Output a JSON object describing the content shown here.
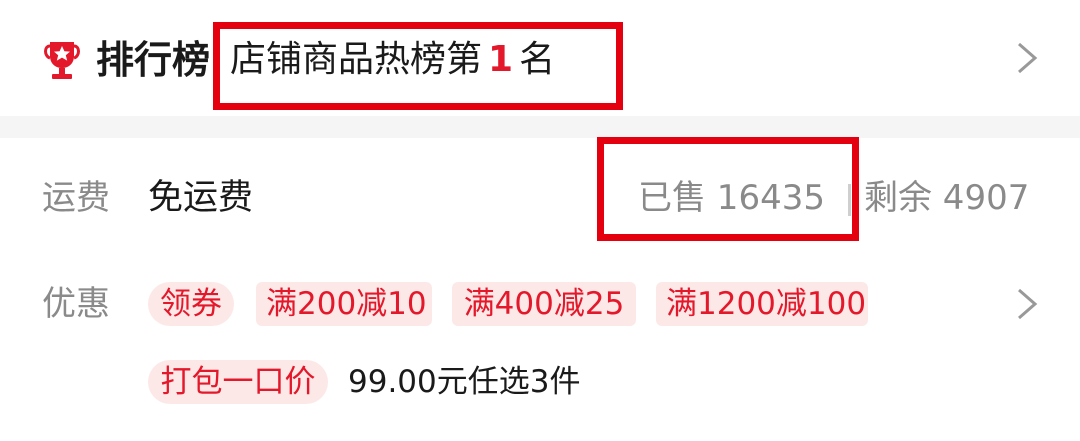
{
  "ranking": {
    "title": "排行榜",
    "text_prefix": "店铺商品热榜第",
    "rank_number": "1",
    "text_suffix": "名",
    "icon": "trophy-icon",
    "accent_color": "#e4182b"
  },
  "shipping": {
    "label": "运费",
    "value": "免运费",
    "sold": "已售 16435",
    "remaining": "剩余 4907"
  },
  "offers": {
    "label": "优惠",
    "coupon": "领券",
    "discounts": [
      "满200减10",
      "满400减25",
      "满1200减100"
    ],
    "bundle_tag": "打包一口价",
    "bundle_text": "99.00元任选3件"
  },
  "colors": {
    "highlight_border": "#e4000f",
    "tag_bg": "#fde8e8",
    "tag_text": "#e4182b",
    "muted": "#8a8a8a"
  }
}
